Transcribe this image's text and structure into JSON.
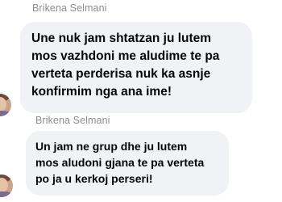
{
  "messages": [
    {
      "sender": "Brikena Selmani",
      "lines": [
        "Une nuk jam shtatzan ju lutem",
        "mos vazhdoni me aludime te pa",
        "verteta perderisa nuk ka asnje",
        "konfirmim nga ana ime!"
      ]
    },
    {
      "sender": "Brikena Selmani",
      "lines": [
        "Un jam ne grup dhe ju lutem",
        "mos aludoni gjana te pa verteta",
        "po ja u kerkoj perseri!"
      ]
    }
  ]
}
